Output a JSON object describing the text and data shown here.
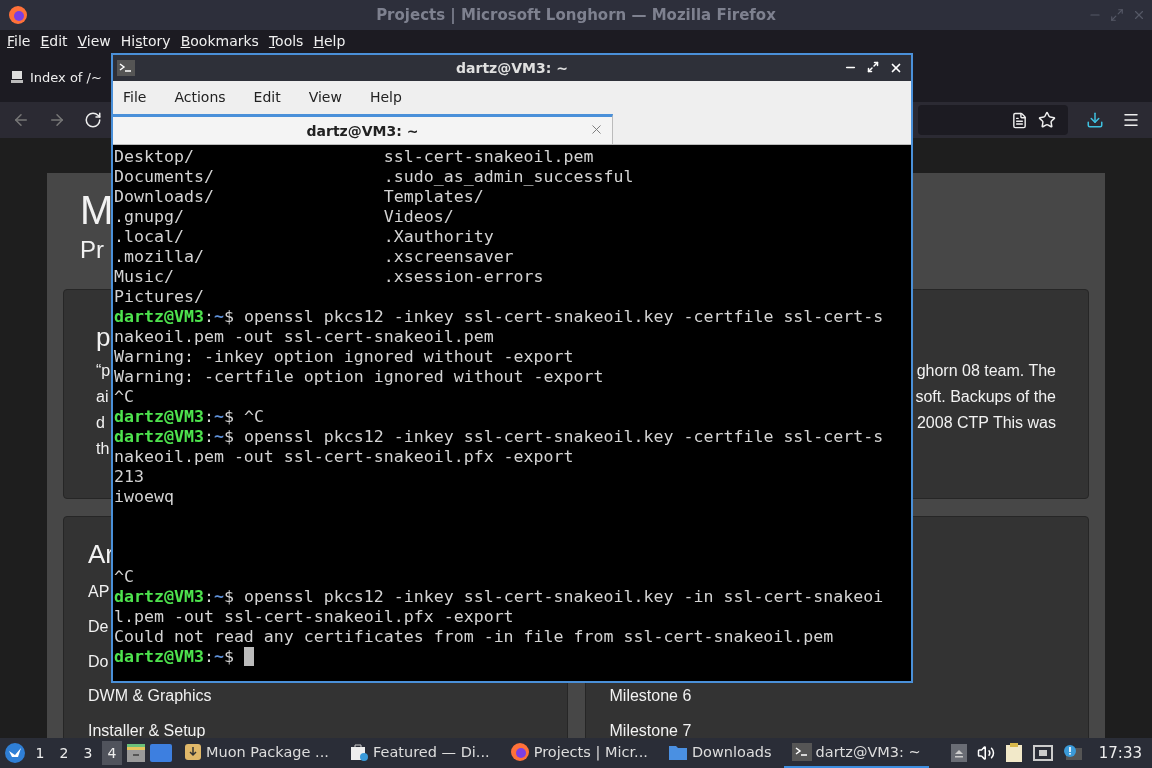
{
  "firefox": {
    "title": "Projects | Microsoft Longhorn — Mozilla Firefox",
    "menu": [
      {
        "key": "F",
        "post": "ile"
      },
      {
        "key": "E",
        "post": "dit"
      },
      {
        "key": "V",
        "post": "iew"
      },
      {
        "pre": "Hi",
        "key": "s",
        "post": "tory"
      },
      {
        "key": "B",
        "post": "ookmarks"
      },
      {
        "key": "T",
        "post": "ools"
      },
      {
        "key": "H",
        "post": "elp"
      }
    ],
    "tab": {
      "label": "Index of /~"
    },
    "page": {
      "title": "M",
      "subtitle": "Pr",
      "intro": {
        "heading": "p",
        "lines": [
          {
            "start": "“p",
            "end": "ghorn 08 team. The"
          },
          {
            "start": "ai",
            "end": "soft. Backups of the"
          },
          {
            "start": "d",
            "end": "2008 CTP This was"
          },
          {
            "start": "th"
          }
        ]
      },
      "areas": {
        "heading": "Ar",
        "items": [
          "AP",
          "De",
          "Do",
          "DWM & Graphics",
          "Installer & Setup"
        ]
      },
      "milestones": {
        "items": [
          "Milestone 6",
          "Milestone 7"
        ]
      }
    }
  },
  "terminal": {
    "title": "dartz@VM3: ~",
    "menu": [
      "File",
      "Actions",
      "Edit",
      "View",
      "Help"
    ],
    "tabs": [
      {
        "label": "dartz@VM3: ~",
        "selected": true
      }
    ],
    "lines": [
      {
        "kind": "columns",
        "left": "Desktop/",
        "right": "ssl-cert-snakeoil.pem"
      },
      {
        "kind": "columns",
        "left": "Documents/",
        "right": ".sudo_as_admin_successful"
      },
      {
        "kind": "columns",
        "left": "Downloads/",
        "right": "Templates/"
      },
      {
        "kind": "columns",
        "left": ".gnupg/",
        "right": "Videos/"
      },
      {
        "kind": "columns",
        "left": ".local/",
        "right": ".Xauthority"
      },
      {
        "kind": "columns",
        "left": ".mozilla/",
        "right": ".xscreensaver"
      },
      {
        "kind": "columns",
        "left": "Music/",
        "right": ".xsession-errors"
      },
      {
        "kind": "output",
        "text": "Pictures/"
      },
      {
        "kind": "prompt",
        "user": "dartz@VM3",
        "colon": ":",
        "path": "~",
        "rest": "$ openssl pkcs12 -inkey ssl-cert-snakeoil.key -certfile ssl-cert-s",
        "cursor": false
      },
      {
        "kind": "output",
        "text": "nakeoil.pem -out ssl-cert-snakeoil.pem"
      },
      {
        "kind": "output",
        "text": "Warning: -inkey option ignored without -export"
      },
      {
        "kind": "output",
        "text": "Warning: -certfile option ignored without -export"
      },
      {
        "kind": "output",
        "text": "^C"
      },
      {
        "kind": "prompt",
        "user": "dartz@VM3",
        "colon": ":",
        "path": "~",
        "rest": "$ ^C",
        "cursor": false
      },
      {
        "kind": "prompt",
        "user": "dartz@VM3",
        "colon": ":",
        "path": "~",
        "rest": "$ openssl pkcs12 -inkey ssl-cert-snakeoil.key -certfile ssl-cert-s",
        "cursor": false
      },
      {
        "kind": "output",
        "text": "nakeoil.pem -out ssl-cert-snakeoil.pfx -export"
      },
      {
        "kind": "output",
        "text": "213"
      },
      {
        "kind": "output",
        "text": "iwoewq"
      },
      {
        "kind": "blank"
      },
      {
        "kind": "blank"
      },
      {
        "kind": "blank"
      },
      {
        "kind": "output",
        "text": "^C"
      },
      {
        "kind": "prompt",
        "user": "dartz@VM3",
        "colon": ":",
        "path": "~",
        "rest": "$ openssl pkcs12 -inkey ssl-cert-snakeoil.key -in ssl-cert-snakeoi",
        "cursor": false
      },
      {
        "kind": "output",
        "text": "l.pem -out ssl-cert-snakeoil.pfx -export"
      },
      {
        "kind": "output",
        "text": "Could not read any certificates from -in file from ssl-cert-snakeoil.pem"
      },
      {
        "kind": "prompt",
        "user": "dartz@VM3",
        "colon": ":",
        "path": "~",
        "rest": "$",
        "cursor": true
      }
    ]
  },
  "taskbar": {
    "workspaces": [
      {
        "label": "1",
        "selected": false
      },
      {
        "label": "2",
        "selected": false
      },
      {
        "label": "3",
        "selected": false
      },
      {
        "label": "4",
        "selected": true
      }
    ],
    "tasks": [
      {
        "kind": "package",
        "label": "Muon Package ...",
        "selected": false
      },
      {
        "kind": "store",
        "label": "Featured — Di...",
        "selected": false
      },
      {
        "kind": "browser",
        "label": "Projects | Micr...",
        "selected": false
      },
      {
        "kind": "folder",
        "label": "Downloads",
        "selected": false
      },
      {
        "kind": "terminal",
        "label": "dartz@VM3: ~",
        "selected": true
      }
    ],
    "clock": "17:33"
  }
}
